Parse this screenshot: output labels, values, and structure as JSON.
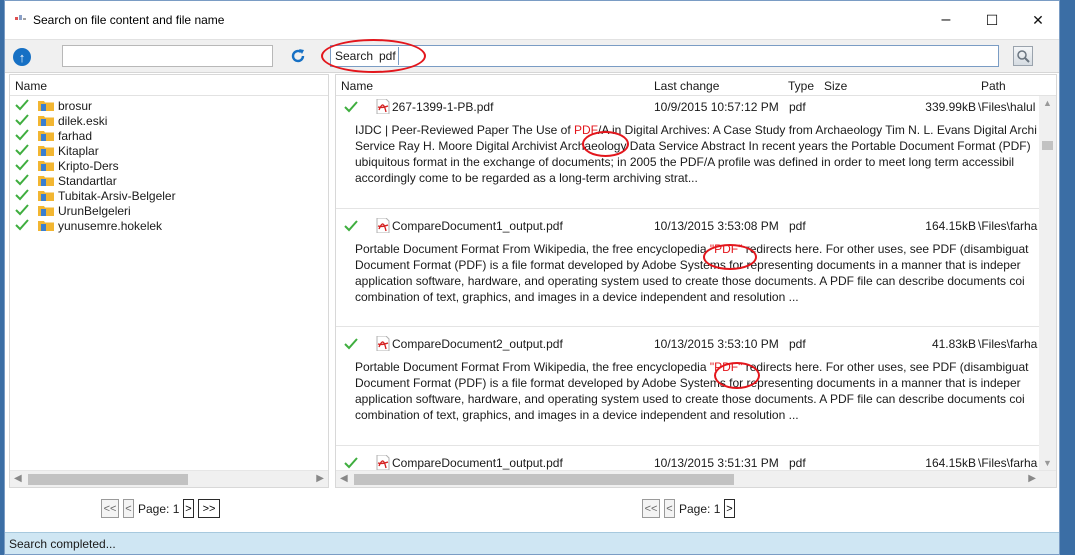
{
  "window": {
    "title": "Search on file content and file name"
  },
  "titlebar_buttons": [
    "–",
    "☐",
    "✕"
  ],
  "toolbar": {
    "path_value": "",
    "search_label": "Search",
    "search_value": "pdf"
  },
  "left_pane": {
    "column_header": "Name",
    "folders": [
      "brosur",
      "dilek.eski",
      "farhad",
      "Kitaplar",
      "Kripto-Ders",
      "Standartlar",
      "Tubitak-Arsiv-Belgeler",
      "UrunBelgeleri",
      "yunusemre.hokelek"
    ]
  },
  "right_pane": {
    "columns": {
      "name": "Name",
      "last_change": "Last change",
      "type": "Type",
      "size": "Size",
      "path": "Path"
    }
  },
  "results": [
    {
      "name": "267-1399-1-PB.pdf",
      "date": "10/9/2015 10:57:12 PM",
      "type": "pdf",
      "size": "339.99kB",
      "path": "\\Files\\halul",
      "lines": [
        [
          "IJDC | Peer-Reviewed Paper The Use of ",
          "PDF",
          "/A in Digital Archives: A Case Study from Archaeology Tim N. L. Evans Digital Archi"
        ],
        [
          "Service Ray H. Moore Digital Archivist Archaeology Data Service Abstract In recent years the Portable Document Format (PDF)",
          "",
          ""
        ],
        [
          "ubiquitous format in the exchange of documents; in 2005 the PDF/A profile was defined in order to meet long term accessibil",
          "",
          ""
        ],
        [
          "accordingly come to be regarded as a long-term archiving strat...",
          "",
          ""
        ]
      ]
    },
    {
      "name": "CompareDocument1_output.pdf",
      "date": "10/13/2015 3:53:08 PM",
      "type": "pdf",
      "size": "164.15kB",
      "path": "\\Files\\farha",
      "lines": [
        [
          "Portable Document Format From Wikipedia, the free encyclopedia ",
          "\"PDF\"",
          " redirects here. For other uses, see PDF (disambiguat"
        ],
        [
          "Document Format (PDF) is a file format developed by Adobe Systems for representing documents in a manner that is indeper",
          "",
          ""
        ],
        [
          "application software, hardware, and operating system used to create those documents. A PDF file can describe documents coi",
          "",
          ""
        ],
        [
          "combination of text, graphics, and images in a device independent and resolution ...",
          "",
          ""
        ]
      ]
    },
    {
      "name": "CompareDocument2_output.pdf",
      "date": "10/13/2015 3:53:10 PM",
      "type": "pdf",
      "size": "41.83kB",
      "path": "\\Files\\farha",
      "lines": [
        [
          "Portable Document Format From Wikipedia, the free encyclopedia ",
          "\"PDF\"",
          " redirects here. For other uses, see PDF (disambiguat"
        ],
        [
          "Document Format (PDF) is a file format developed by Adobe Systems for representing documents in a manner that is indeper",
          "",
          ""
        ],
        [
          "application software, hardware, and operating system used to create those documents. A PDF file can describe documents coi",
          "",
          ""
        ],
        [
          "combination of text, graphics, and images in a device independent and resolution ...",
          "",
          ""
        ]
      ]
    },
    {
      "name": "CompareDocument1_output.pdf",
      "date": "10/13/2015 3:51:31 PM",
      "type": "pdf",
      "size": "164.15kB",
      "path": "\\Files\\farha",
      "lines": []
    }
  ],
  "pager_left": {
    "first": "<<",
    "prev": "<",
    "page_label": "Page: 1",
    "next": ">",
    "last": ">>"
  },
  "pager_right": {
    "first": "<<",
    "prev": "<",
    "page_label": "Page: 1",
    "next": ">"
  },
  "status": {
    "text": "Search completed..."
  },
  "colors": {
    "accent": "#1670c4",
    "highlight": "#e3161c",
    "statusbar": "#cfe6f3",
    "check": "#3fae3f",
    "folder": "#f2b632"
  }
}
